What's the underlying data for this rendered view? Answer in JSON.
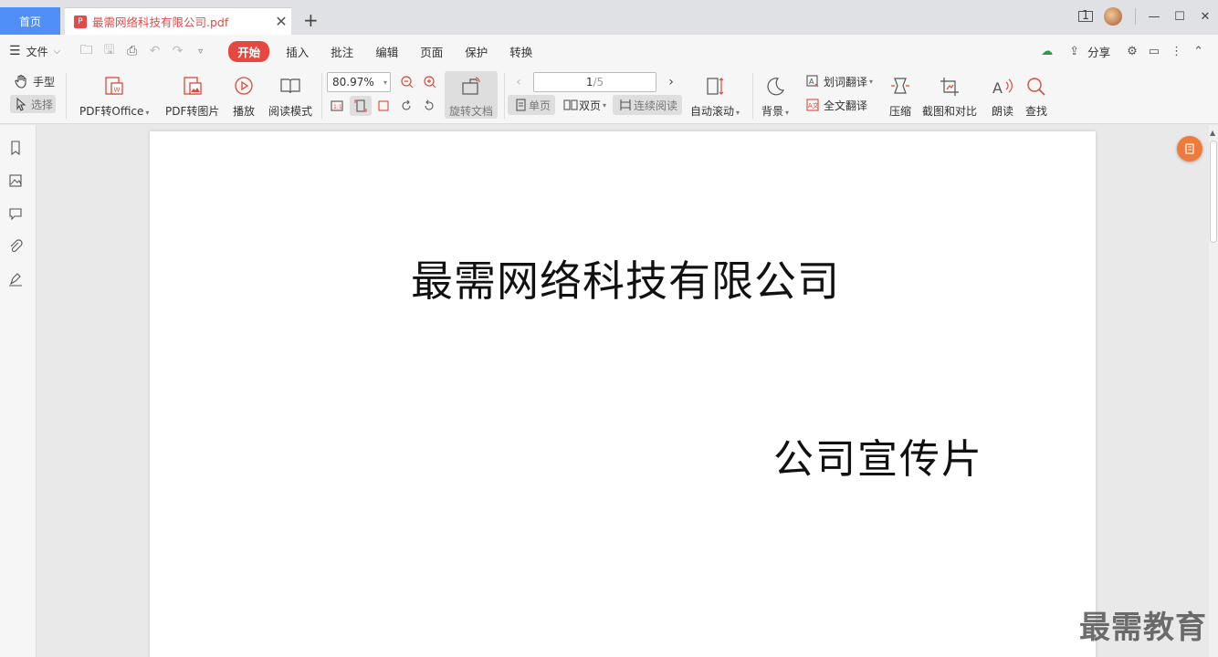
{
  "tabs": {
    "home_label": "首页",
    "doc_title": "最需网络科技有限公司.pdf",
    "doc_icon": "pdf-icon"
  },
  "window": {
    "badge_number": "1"
  },
  "menubar": {
    "file_label": "文件",
    "start_label": "开始",
    "items": [
      "插入",
      "批注",
      "编辑",
      "页面",
      "保护",
      "转换"
    ],
    "share_label": "分享"
  },
  "toolbar": {
    "hand_label": "手型",
    "select_label": "选择",
    "pdf_to_office": "PDF转Office",
    "pdf_to_image": "PDF转图片",
    "play": "播放",
    "read_mode": "阅读模式",
    "zoom_value": "80.97%",
    "rotate_doc": "旋转文档",
    "page_current": "1",
    "page_total": "/5",
    "single_page": "单页",
    "double_page": "双页",
    "continuous": "连续阅读",
    "auto_scroll": "自动滚动",
    "background": "背景",
    "word_translate": "划词翻译",
    "full_translate": "全文翻译",
    "compress": "压缩",
    "screenshot_compare": "截图和对比",
    "read_aloud": "朗读",
    "find": "查找",
    "accent_color": "#e6483f"
  },
  "document": {
    "title": "最需网络科技有限公司",
    "subtitle": "公司宣传片"
  },
  "watermark": "最需教育"
}
